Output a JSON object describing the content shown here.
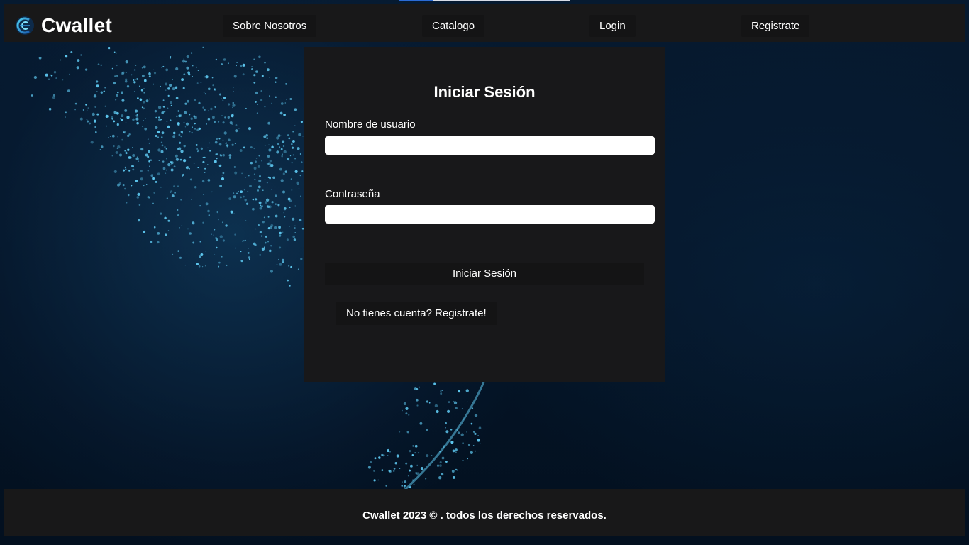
{
  "header": {
    "brand_name": "Cwallet",
    "logo_icon": "cwallet-logo-icon",
    "nav": [
      {
        "label": "Sobre Nosotros"
      },
      {
        "label": "Catalogo"
      },
      {
        "label": "Login"
      },
      {
        "label": "Registrate"
      }
    ]
  },
  "login": {
    "title": "Iniciar Sesión",
    "username_label": "Nombre de usuario",
    "username_value": "",
    "password_label": "Contraseña",
    "password_value": "",
    "submit_label": "Iniciar Sesión",
    "register_link": "No tienes cuenta? Registrate!"
  },
  "footer": {
    "text": "Cwallet 2023 © . todos los derechos reservados."
  },
  "colors": {
    "panel": "#18181a",
    "button": "#141415",
    "background": "#041426",
    "glow": "#5ec8f0"
  }
}
